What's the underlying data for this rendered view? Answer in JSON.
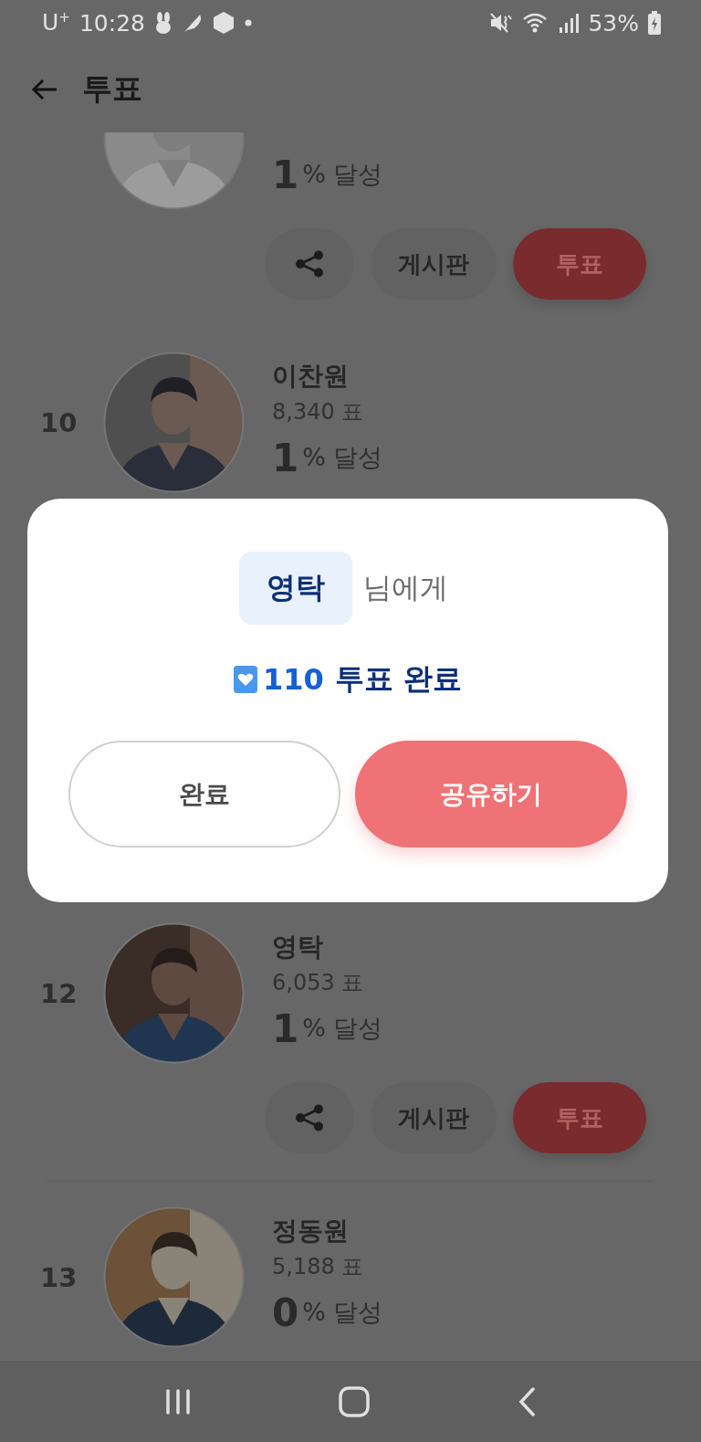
{
  "status_bar": {
    "carrier": "U$^{+}$",
    "time": "10:28",
    "battery": "53%"
  },
  "header": {
    "title": "투표"
  },
  "candidates": [
    {
      "percent": "1",
      "percent_label": "% 달성",
      "board_label": "게시판",
      "vote_label": "투표"
    },
    {
      "rank": "10",
      "name": "이찬원",
      "votes": "8,340 표",
      "percent": "1",
      "percent_label": "% 달성"
    },
    {
      "rank": "12",
      "name": "영탁",
      "votes": "6,053 표",
      "percent": "1",
      "percent_label": "% 달성",
      "board_label": "게시판",
      "vote_label": "투표"
    },
    {
      "rank": "13",
      "name": "정동원",
      "votes": "5,188 표",
      "percent": "0",
      "percent_label": "% 달성"
    }
  ],
  "modal": {
    "recipient": "영탁",
    "recipient_suffix": "님에게",
    "vote_count": "110",
    "vote_result": "투표 완료",
    "buttons": [
      {
        "label": "완료",
        "kind": "outline"
      },
      {
        "label": "공유하기",
        "kind": "primary"
      }
    ]
  }
}
